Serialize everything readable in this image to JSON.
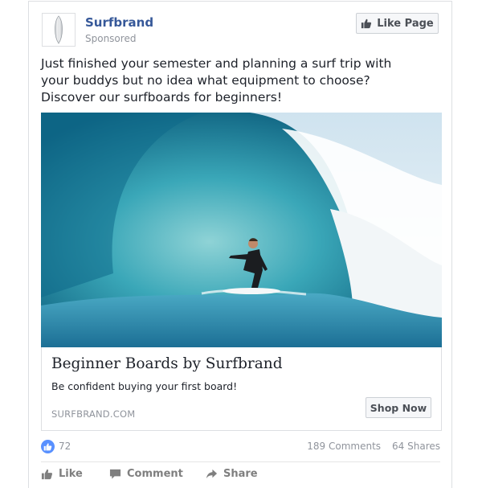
{
  "page": {
    "name": "Surfbrand",
    "sponsored": "Sponsored",
    "like_page_label": "Like Page"
  },
  "post": {
    "text": "Just finished your semester and planning a surf trip with your buddys but no idea what equipment to choose? Discover our surfboards for beginners!"
  },
  "link": {
    "title": "Beginner Boards by Surfbrand",
    "description": "Be confident buying your first board!",
    "domain": "SURFBRAND.COM",
    "cta_label": "Shop Now"
  },
  "stats": {
    "likes": "72",
    "comments": "189 Comments",
    "shares": "64 Shares"
  },
  "actions": {
    "like": "Like",
    "comment": "Comment",
    "share": "Share"
  },
  "colors": {
    "brand_link": "#365899",
    "like_blue": "#5890ff",
    "muted": "#90949c"
  },
  "icons": [
    "surfboard-logo-icon",
    "thumbs-up-icon",
    "comment-icon",
    "share-icon"
  ]
}
